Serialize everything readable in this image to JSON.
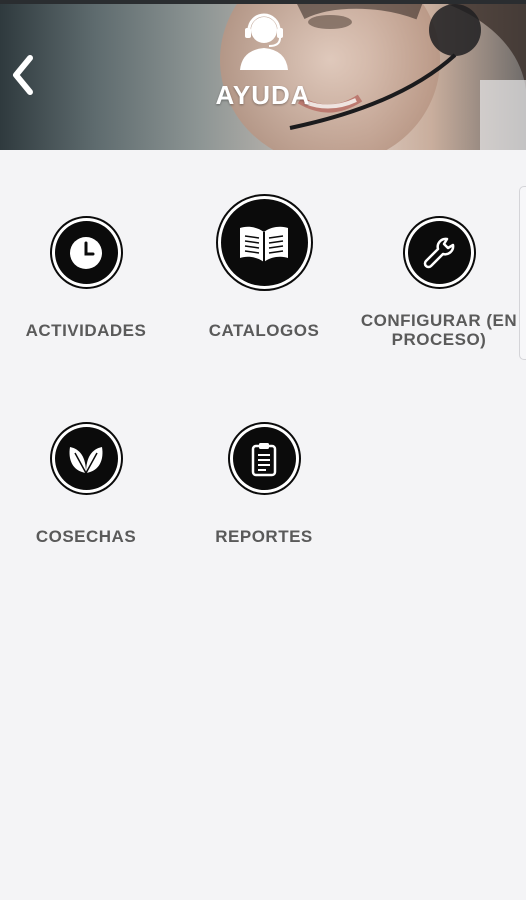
{
  "header": {
    "title": "AYUDA",
    "back_icon": "chevron-left-icon",
    "title_icon": "headset-agent-icon"
  },
  "menu": {
    "items": [
      {
        "label": "ACTIVIDADES",
        "icon": "clock-icon"
      },
      {
        "label": "CATALOGOS",
        "icon": "book-icon"
      },
      {
        "label": "CONFIGURAR (EN\nPROCESO)",
        "icon": "wrench-icon"
      },
      {
        "label": "COSECHAS",
        "icon": "leaves-icon"
      },
      {
        "label": "REPORTES",
        "icon": "clipboard-icon"
      }
    ]
  },
  "colors": {
    "background": "#f4f4f6",
    "icon_circle": "#0b0b0b",
    "label_text": "#5a5a5a",
    "header_text": "#ffffff"
  }
}
